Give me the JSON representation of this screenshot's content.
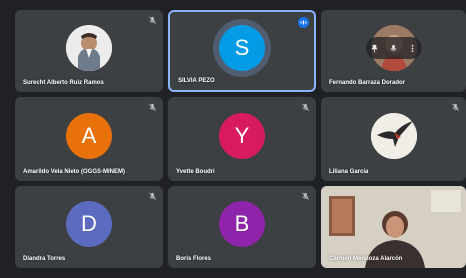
{
  "participants": [
    {
      "name": "Surecht Alberto Ruiz Ramos",
      "type": "photo",
      "muted": true
    },
    {
      "name": "SILVIA PEZO",
      "type": "initial",
      "initial": "S",
      "color": "#039be5",
      "speaking": true
    },
    {
      "name": "Fernando Barraza Dorador",
      "type": "photo",
      "muted": false
    },
    {
      "name": "Amarildo Vela Nieto (OGGS-MINEM)",
      "type": "initial",
      "initial": "A",
      "color": "#e8710a",
      "muted": true
    },
    {
      "name": "Yvette Boudri",
      "type": "initial",
      "initial": "Y",
      "color": "#d81b60",
      "muted": true
    },
    {
      "name": "Liliana García",
      "type": "photo",
      "muted": true
    },
    {
      "name": "Diandra Torres",
      "type": "initial",
      "initial": "D",
      "color": "#5c6bc0",
      "muted": true
    },
    {
      "name": "Boris Flores",
      "type": "initial",
      "initial": "B",
      "color": "#8e24aa",
      "muted": true
    },
    {
      "name": "Carmen Mendoza Alarcón",
      "type": "video",
      "muted": false
    }
  ],
  "colors": {
    "background": "#202124",
    "tile": "#3c4043",
    "active_border": "#8ab4f8",
    "speaking_badge": "#1a73e8"
  },
  "icons": [
    "mic-off-icon",
    "speaking-indicator-icon",
    "pin-icon",
    "more-options-icon"
  ]
}
